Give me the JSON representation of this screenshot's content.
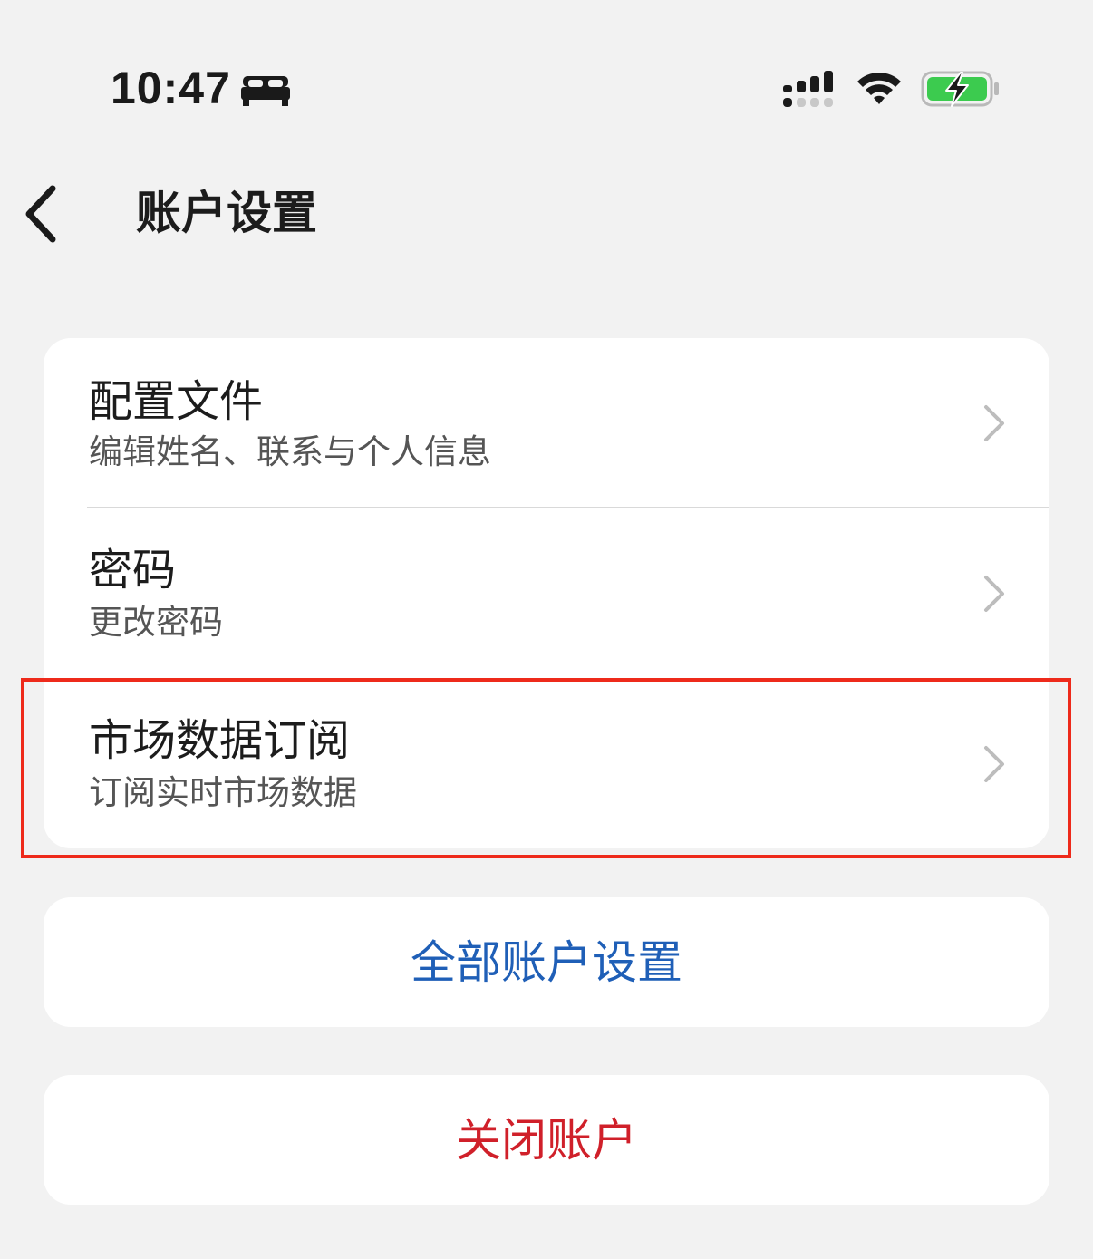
{
  "status_bar": {
    "time": "10:47",
    "focus_icon": "bed-icon",
    "signal_icon": "signal-icon",
    "wifi_icon": "wifi-icon",
    "battery_icon": "battery-charging-icon",
    "battery_color": "#3ccb4f"
  },
  "nav": {
    "back_icon": "chevron-left-icon",
    "title": "账户设置"
  },
  "settings": {
    "items": [
      {
        "title": "配置文件",
        "subtitle": "编辑姓名、联系与个人信息"
      },
      {
        "title": "密码",
        "subtitle": "更改密码"
      },
      {
        "title": "市场数据订阅",
        "subtitle": "订阅实时市场数据",
        "highlighted": true
      }
    ]
  },
  "actions": {
    "all_settings_label": "全部账户设置",
    "close_account_label": "关闭账户"
  },
  "colors": {
    "background": "#f2f2f2",
    "card": "#ffffff",
    "link_blue": "#1f5fb7",
    "danger_red": "#d0202a",
    "highlight_red": "#ee2a1b"
  }
}
